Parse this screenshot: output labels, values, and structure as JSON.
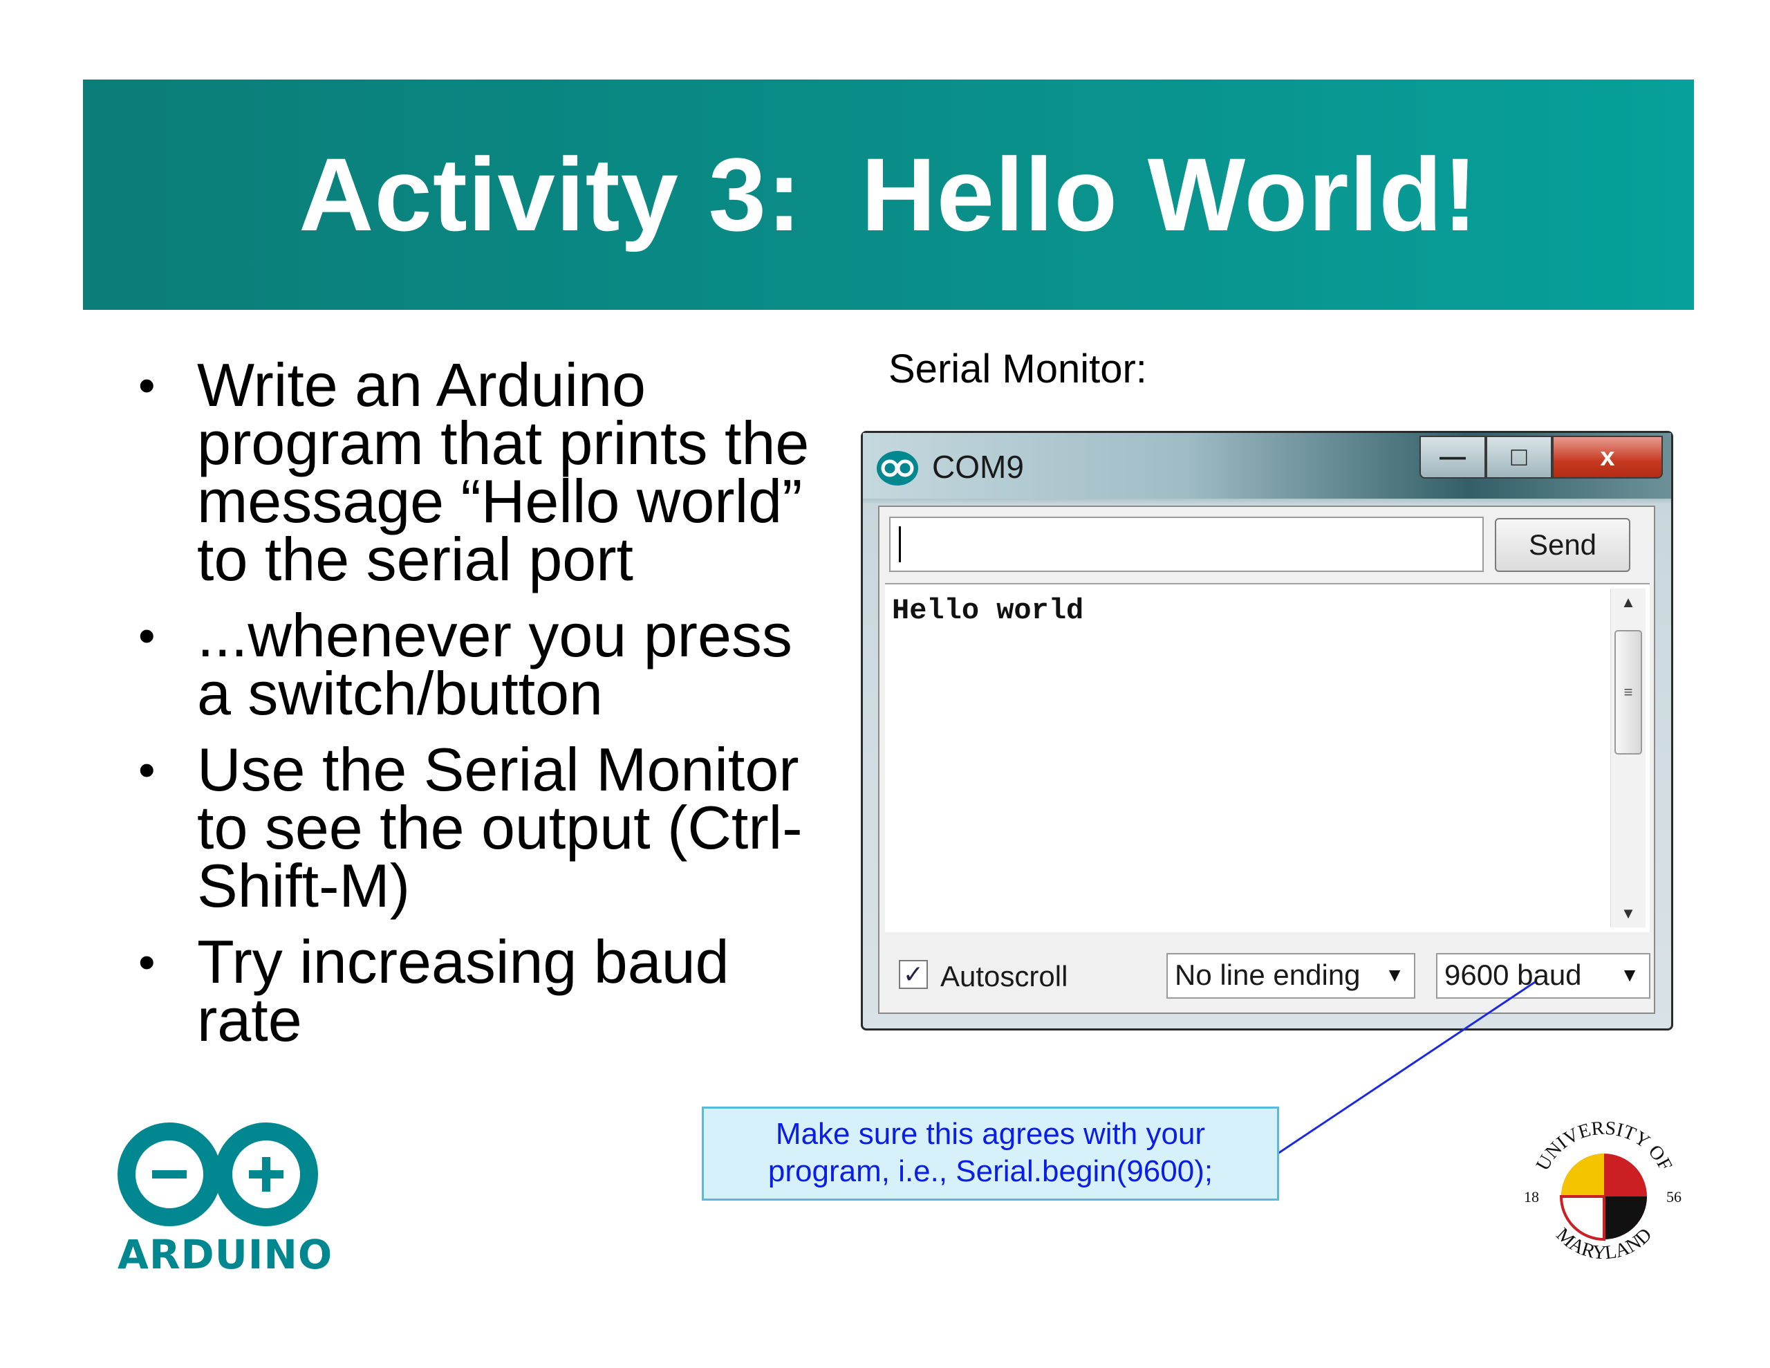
{
  "slide": {
    "title": "Activity 3:  Hello World!",
    "bullets": [
      "Write an Arduino program that prints the message “Hello world” to the serial port",
      "...whenever you press a switch/button",
      "Use the Serial Monitor to see the output (Ctrl-Shift-M)",
      "Try increasing baud rate"
    ],
    "bullet_marker": "•",
    "serial_monitor_label": "Serial Monitor:",
    "callout_lines": [
      "Make sure this agrees with your",
      "program, i.e., Serial.begin(9600);"
    ],
    "arduino_logo_text": "ARDUINO",
    "seal": {
      "top": "UNIVERSITY OF",
      "bottom": "MARYLAND",
      "year_left": "18",
      "year_right": "56"
    },
    "colors": {
      "banner": "#0a8d88",
      "callout_text": "#0a1ee6",
      "arduino": "#00878f"
    }
  },
  "window": {
    "title": "COM9",
    "controls": {
      "minimize": "—",
      "maximize": "□",
      "close": "x"
    },
    "send_input_value": "",
    "send_label": "Send",
    "output": "Hello world",
    "autoscroll_label": "Autoscroll",
    "autoscroll_checked": "✓",
    "line_ending": "No line ending",
    "baud": "9600 baud",
    "select_arrow": "▼",
    "scroll_up": "▲",
    "scroll_down": "▼",
    "scroll_grip": "≡"
  }
}
